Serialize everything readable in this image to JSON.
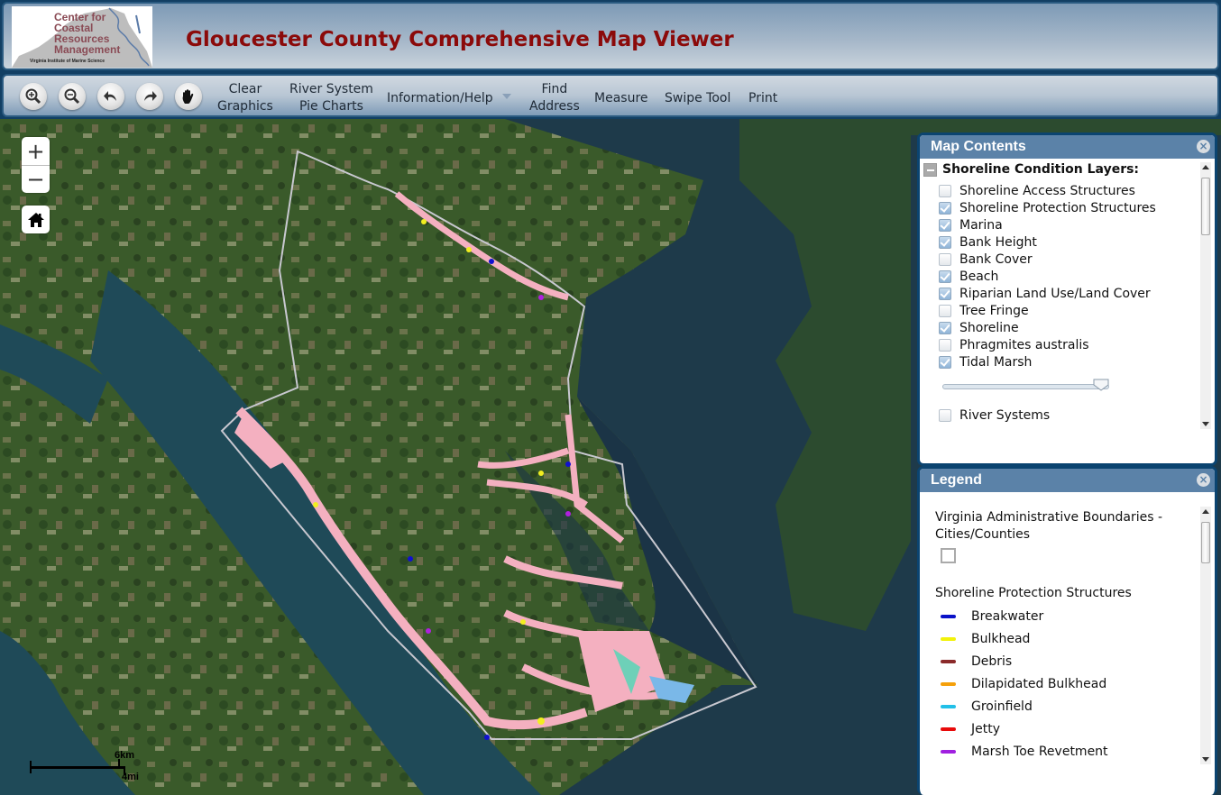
{
  "header": {
    "logo": {
      "line1": "Center for",
      "line2": "Coastal",
      "line3": "Resources",
      "line4": "Management",
      "subtitle": "Virginia Institute of Marine Science"
    },
    "title": "Gloucester County Comprehensive Map Viewer",
    "title_color": "#8b0a0a"
  },
  "toolbar": {
    "icon_buttons": [
      {
        "name": "zoom-in",
        "icon": "zoom-in-icon"
      },
      {
        "name": "zoom-out",
        "icon": "zoom-out-icon"
      },
      {
        "name": "previous-extent",
        "icon": "undo-arrow-icon"
      },
      {
        "name": "next-extent",
        "icon": "redo-arrow-icon"
      },
      {
        "name": "pan",
        "icon": "hand-icon"
      }
    ],
    "clear_graphics": {
      "line1": "Clear",
      "line2": "Graphics"
    },
    "river_pie": {
      "line1": "River System",
      "line2": "Pie Charts"
    },
    "info_help": "Information/Help",
    "find_address": {
      "line1": "Find",
      "line2": "Address"
    },
    "measure": "Measure",
    "swipe": "Swipe Tool",
    "print": "Print"
  },
  "map": {
    "zoom_in": "+",
    "zoom_out": "−",
    "home_icon": "home-icon",
    "scale": {
      "km": "6km",
      "mi": "4mi"
    }
  },
  "contents": {
    "title": "Map Contents",
    "group": "Shoreline Condition Layers:",
    "layers": [
      {
        "label": "Shoreline Access Structures",
        "checked": false
      },
      {
        "label": "Shoreline Protection Structures",
        "checked": true
      },
      {
        "label": "Marina",
        "checked": true
      },
      {
        "label": "Bank Height",
        "checked": true
      },
      {
        "label": "Bank Cover",
        "checked": false
      },
      {
        "label": "Beach",
        "checked": true
      },
      {
        "label": "Riparian Land Use/Land Cover",
        "checked": true
      },
      {
        "label": "Tree Fringe",
        "checked": false
      },
      {
        "label": "Shoreline",
        "checked": true
      },
      {
        "label": "Phragmites australis",
        "checked": false
      },
      {
        "label": "Tidal Marsh",
        "checked": true
      }
    ],
    "opacity": 0.95,
    "river_systems": {
      "label": "River Systems",
      "checked": false
    }
  },
  "legend": {
    "title": "Legend",
    "boundaries_title": "Virginia Administrative Boundaries -",
    "boundaries_title2": "Cities/Counties",
    "sps_title": "Shoreline Protection Structures",
    "items": [
      {
        "label": "Breakwater",
        "color": "#0a12c8"
      },
      {
        "label": "Bulkhead",
        "color": "#f2f20a"
      },
      {
        "label": "Debris",
        "color": "#8b2a2a"
      },
      {
        "label": "Dilapidated Bulkhead",
        "color": "#f5a00a"
      },
      {
        "label": "Groinfield",
        "color": "#22c0e8"
      },
      {
        "label": "Jetty",
        "color": "#e80a0a"
      },
      {
        "label": "Marsh Toe Revetment",
        "color": "#a020e0"
      }
    ]
  }
}
